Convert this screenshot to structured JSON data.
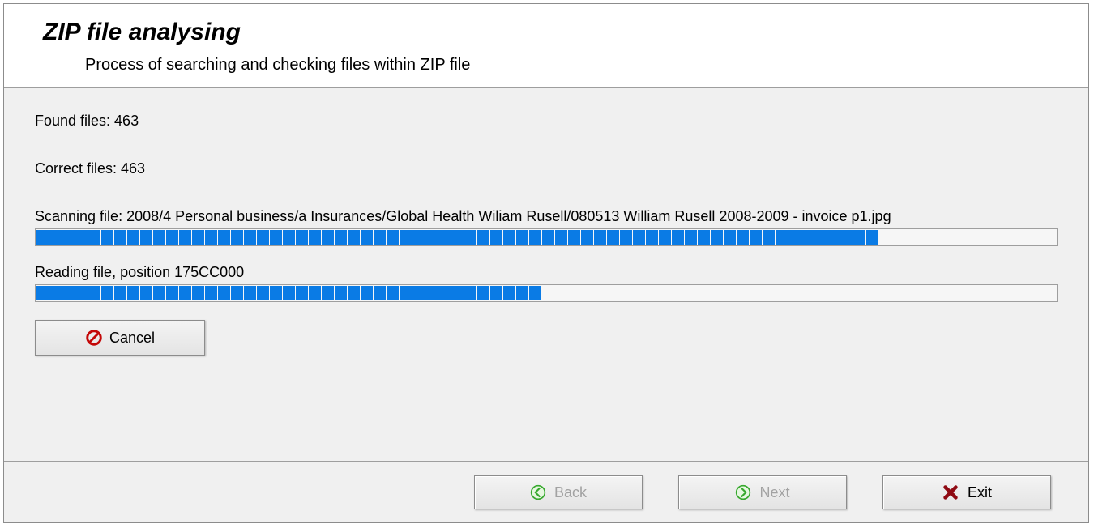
{
  "header": {
    "title": "ZIP file analysing",
    "subtitle": "Process of searching and checking files within ZIP file"
  },
  "body": {
    "found_label": "Found files: 463",
    "correct_label": "Correct files: 463",
    "scan_label": "Scanning file: 2008/4 Personal business/a Insurances/Global Health Wiliam Rusell/080513 William Rusell 2008-2009 - invoice p1.jpg",
    "scan_percent": 83,
    "read_label": "Reading file, position 175CC000",
    "read_percent": 50,
    "cancel_label": "Cancel"
  },
  "footer": {
    "back_label": "Back",
    "next_label": "Next",
    "exit_label": "Exit"
  }
}
